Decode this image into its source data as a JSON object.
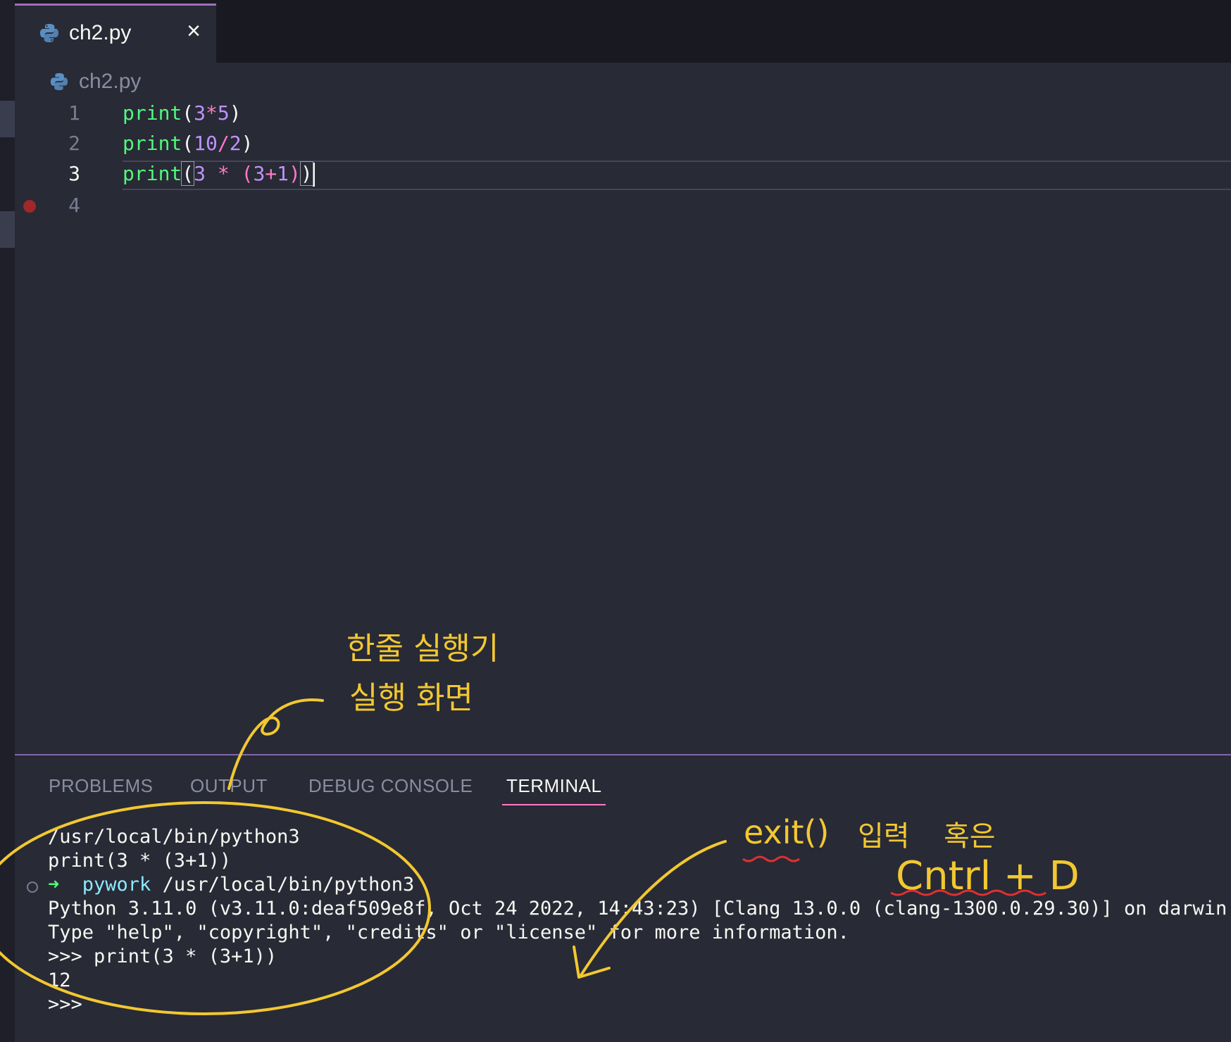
{
  "editor": {
    "tab": {
      "label": "ch2.py",
      "close_icon": "×"
    },
    "breadcrumb": {
      "file": "ch2.py"
    },
    "lines": [
      {
        "number": "1",
        "fn": "print",
        "open": "(",
        "a": "3",
        "op": "*",
        "b": "5",
        "close": ")"
      },
      {
        "number": "2",
        "fn": "print",
        "open": "(",
        "a": "10",
        "op": "/",
        "b": "2",
        "close": ")"
      },
      {
        "number": "3",
        "fn": "print",
        "open": "(",
        "a": "3",
        "op": " * ",
        "inner_open": "(",
        "b": "3",
        "op2": "+",
        "c": "1",
        "inner_close": ")",
        "close": ")"
      },
      {
        "number": "4"
      }
    ]
  },
  "panel": {
    "tabs": [
      "PROBLEMS",
      "OUTPUT",
      "DEBUG CONSOLE",
      "TERMINAL"
    ],
    "active_tab": "TERMINAL"
  },
  "terminal": {
    "line1": "/usr/local/bin/python3",
    "line2": "print(3 * (3+1))",
    "prompt_arrow": "➜",
    "prompt_dir": "pywork",
    "prompt_cmd": " /usr/local/bin/python3",
    "line4": "Python 3.11.0 (v3.11.0:deaf509e8f, Oct 24 2022, 14:43:23) [Clang 13.0.0 (clang-1300.0.29.30)] on darwin",
    "line5": "Type \"help\", \"copyright\", \"credits\" or \"license\" for more information.",
    "line6": ">>> print(3 * (3+1))",
    "line7": "12",
    "line8": ">>>"
  },
  "annotations": {
    "korean_line1": "한줄 실행기",
    "korean_line2": "실행 화면",
    "exit_text": "exit()",
    "input_text": "입력",
    "or_text": "혹은",
    "ctrl_d": "Cntrl + D"
  },
  "colors": {
    "background": "#282a36",
    "function": "#50fa7b",
    "number": "#bd93f9",
    "operator": "#ff79c6",
    "annotation": "#f2c830",
    "underline": "#e03030"
  }
}
